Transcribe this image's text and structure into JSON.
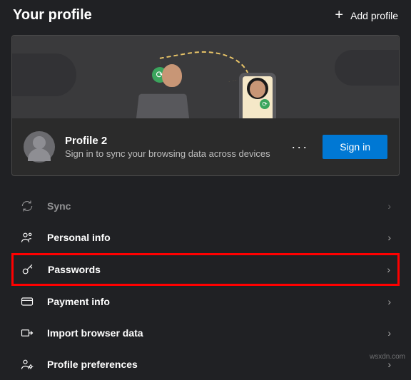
{
  "header": {
    "title": "Your profile",
    "add_profile_label": "Add profile"
  },
  "profile": {
    "name": "Profile 2",
    "subtitle": "Sign in to sync your browsing data across devices",
    "signin_label": "Sign in"
  },
  "menu": {
    "items": [
      {
        "key": "sync",
        "label": "Sync",
        "enabled": false
      },
      {
        "key": "personal-info",
        "label": "Personal info",
        "enabled": true
      },
      {
        "key": "passwords",
        "label": "Passwords",
        "enabled": true,
        "highlighted": true
      },
      {
        "key": "payment-info",
        "label": "Payment info",
        "enabled": true
      },
      {
        "key": "import-browser-data",
        "label": "Import browser data",
        "enabled": true
      },
      {
        "key": "profile-preferences",
        "label": "Profile preferences",
        "enabled": true
      }
    ]
  },
  "watermark": "wsxdn.com"
}
